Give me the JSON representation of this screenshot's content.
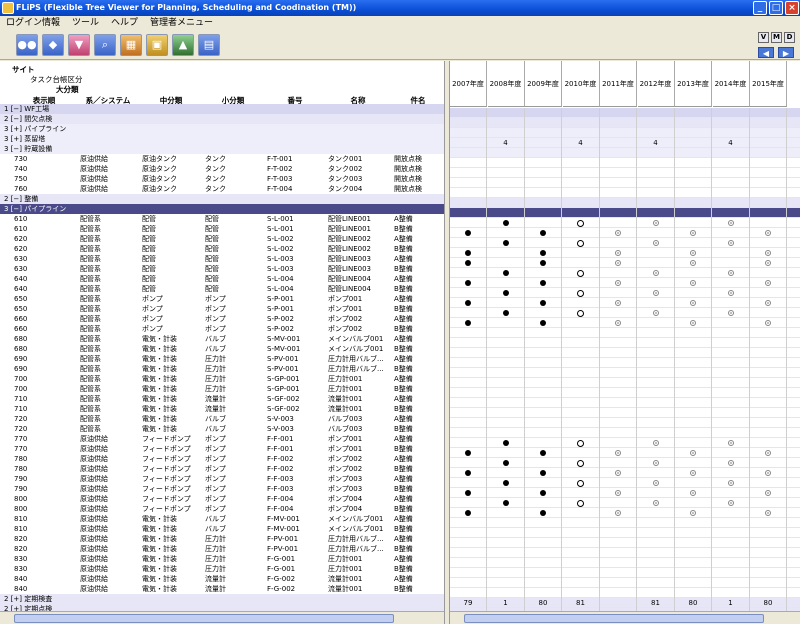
{
  "window": {
    "title": "FLiPS (Flexible Tree Viewer for Planning, Scheduling and Coodination (TM))"
  },
  "menu": [
    "ログイン情報",
    "ツール",
    "ヘルプ",
    "管理者メニュー"
  ],
  "toolbar": {
    "buttons": [
      "people-icon",
      "group-icon",
      "filter-icon",
      "search-icon",
      "grid-icon",
      "tree-icon",
      "chart-icon",
      "export-icon"
    ],
    "small": [
      "V",
      "M",
      "D"
    ]
  },
  "header": {
    "site": "サイト",
    "task": "タスク台帳区分",
    "major": "大分類",
    "cols": [
      "表示順",
      "系／システム",
      "中分類",
      "小分類",
      "番号",
      "名称",
      "件名"
    ]
  },
  "years": [
    "2007年度",
    "2008年度",
    "2009年度",
    "2010年度",
    "2011年度",
    "2012年度",
    "2013年度",
    "2014年度",
    "2015年度"
  ],
  "rows": [
    {
      "k": "g1",
      "label": "1 [−]  WF工場",
      "cells": []
    },
    {
      "k": "g2",
      "label": "2    [−]  間欠点検",
      "cells": []
    },
    {
      "k": "g3",
      "label": "3         [+]  パイプライン",
      "cells": []
    },
    {
      "k": "g3",
      "label": "3         [+]  蒸留塔",
      "cells": [
        "",
        "4",
        "",
        "4",
        "",
        "4",
        "",
        "4",
        ""
      ]
    },
    {
      "k": "g3",
      "label": "3         [−]  貯蔵設備",
      "cells": []
    },
    {
      "k": "d",
      "v": [
        "730",
        "原油供給",
        "原油タンク",
        "タンク",
        "F-T-001",
        "タンク001",
        "開放点検"
      ],
      "cells": []
    },
    {
      "k": "d",
      "v": [
        "740",
        "原油供給",
        "原油タンク",
        "タンク",
        "F-T-002",
        "タンク002",
        "開放点検"
      ],
      "cells": []
    },
    {
      "k": "d",
      "v": [
        "750",
        "原油供給",
        "原油タンク",
        "タンク",
        "F-T-003",
        "タンク003",
        "開放点検"
      ],
      "cells": []
    },
    {
      "k": "d",
      "v": [
        "760",
        "原油供給",
        "原油タンク",
        "タンク",
        "F-T-004",
        "タンク004",
        "開放点検"
      ],
      "cells": []
    },
    {
      "k": "g2",
      "label": "2    [−]  整備",
      "cells": []
    },
    {
      "k": "sel",
      "label": "3         [−]  パイプライン",
      "cells": []
    },
    {
      "k": "d",
      "v": [
        "610",
        "配管系",
        "配管",
        "配管",
        "S-L-001",
        "配管LINE001",
        "A整備"
      ],
      "cells": [
        "",
        "b",
        "",
        "o",
        "",
        "d",
        "",
        "d",
        ""
      ]
    },
    {
      "k": "d",
      "v": [
        "610",
        "配管系",
        "配管",
        "配管",
        "S-L-001",
        "配管LINE001",
        "B整備"
      ],
      "cells": [
        "b",
        "",
        "b",
        "",
        "d",
        "",
        "d",
        "",
        "d"
      ]
    },
    {
      "k": "d",
      "v": [
        "620",
        "配管系",
        "配管",
        "配管",
        "S-L-002",
        "配管LINE002",
        "A整備"
      ],
      "cells": [
        "",
        "b",
        "",
        "o",
        "",
        "d",
        "",
        "d",
        ""
      ]
    },
    {
      "k": "d",
      "v": [
        "620",
        "配管系",
        "配管",
        "配管",
        "S-L-002",
        "配管LINE002",
        "B整備"
      ],
      "cells": [
        "b",
        "",
        "b",
        "",
        "d",
        "",
        "d",
        "",
        "d"
      ]
    },
    {
      "k": "d",
      "v": [
        "630",
        "配管系",
        "配管",
        "配管",
        "S-L-003",
        "配管LINE003",
        "A整備"
      ],
      "cells": [
        "b",
        "",
        "b",
        "",
        "d",
        "",
        "d",
        "",
        "d"
      ]
    },
    {
      "k": "d",
      "v": [
        "630",
        "配管系",
        "配管",
        "配管",
        "S-L-003",
        "配管LINE003",
        "B整備"
      ],
      "cells": [
        "",
        "b",
        "",
        "o",
        "",
        "d",
        "",
        "d",
        ""
      ]
    },
    {
      "k": "d",
      "v": [
        "640",
        "配管系",
        "配管",
        "配管",
        "S-L-004",
        "配管LINE004",
        "A整備"
      ],
      "cells": [
        "b",
        "",
        "b",
        "",
        "d",
        "",
        "d",
        "",
        "d"
      ]
    },
    {
      "k": "d",
      "v": [
        "640",
        "配管系",
        "配管",
        "配管",
        "S-L-004",
        "配管LINE004",
        "B整備"
      ],
      "cells": [
        "",
        "b",
        "",
        "o",
        "",
        "d",
        "",
        "d",
        ""
      ]
    },
    {
      "k": "d",
      "v": [
        "650",
        "配管系",
        "ポンプ",
        "ポンプ",
        "S-P-001",
        "ポンプ001",
        "A整備"
      ],
      "cells": [
        "b",
        "",
        "b",
        "",
        "d",
        "",
        "d",
        "",
        "d"
      ]
    },
    {
      "k": "d",
      "v": [
        "650",
        "配管系",
        "ポンプ",
        "ポンプ",
        "S-P-001",
        "ポンプ001",
        "B整備"
      ],
      "cells": [
        "",
        "b",
        "",
        "o",
        "",
        "d",
        "",
        "d",
        ""
      ]
    },
    {
      "k": "d",
      "v": [
        "660",
        "配管系",
        "ポンプ",
        "ポンプ",
        "S-P-002",
        "ポンプ002",
        "A整備"
      ],
      "cells": [
        "b",
        "",
        "b",
        "",
        "d",
        "",
        "d",
        "",
        "d"
      ]
    },
    {
      "k": "d",
      "v": [
        "660",
        "配管系",
        "ポンプ",
        "ポンプ",
        "S-P-002",
        "ポンプ002",
        "B整備"
      ],
      "cells": []
    },
    {
      "k": "d",
      "v": [
        "680",
        "配管系",
        "電気・計装",
        "バルブ",
        "S-MV-001",
        "メインバルブ001",
        "A整備"
      ],
      "cells": []
    },
    {
      "k": "d",
      "v": [
        "680",
        "配管系",
        "電気・計装",
        "バルブ",
        "S-MV-001",
        "メインバルブ001",
        "B整備"
      ],
      "cells": []
    },
    {
      "k": "d",
      "v": [
        "690",
        "配管系",
        "電気・計装",
        "圧力計",
        "S-PV-001",
        "圧力計用バルブ...",
        "A整備"
      ],
      "cells": []
    },
    {
      "k": "d",
      "v": [
        "690",
        "配管系",
        "電気・計装",
        "圧力計",
        "S-PV-001",
        "圧力計用バルブ...",
        "B整備"
      ],
      "cells": []
    },
    {
      "k": "d",
      "v": [
        "700",
        "配管系",
        "電気・計装",
        "圧力計",
        "S-GP-001",
        "圧力計001",
        "A整備"
      ],
      "cells": []
    },
    {
      "k": "d",
      "v": [
        "700",
        "配管系",
        "電気・計装",
        "圧力計",
        "S-GP-001",
        "圧力計001",
        "B整備"
      ],
      "cells": []
    },
    {
      "k": "d",
      "v": [
        "710",
        "配管系",
        "電気・計装",
        "流量計",
        "S-GF-002",
        "流量計001",
        "A整備"
      ],
      "cells": []
    },
    {
      "k": "d",
      "v": [
        "710",
        "配管系",
        "電気・計装",
        "流量計",
        "S-GF-002",
        "流量計001",
        "B整備"
      ],
      "cells": []
    },
    {
      "k": "d",
      "v": [
        "720",
        "配管系",
        "電気・計装",
        "バルブ",
        "S-V-003",
        "バルブ003",
        "A整備"
      ],
      "cells": []
    },
    {
      "k": "d",
      "v": [
        "720",
        "配管系",
        "電気・計装",
        "バルブ",
        "S-V-003",
        "バルブ003",
        "B整備"
      ],
      "cells": []
    },
    {
      "k": "d",
      "v": [
        "770",
        "原油供給",
        "フィードポンプ",
        "ポンプ",
        "F-F-001",
        "ポンプ001",
        "A整備"
      ],
      "cells": [
        "",
        "b",
        "",
        "o",
        "",
        "d",
        "",
        "d",
        ""
      ]
    },
    {
      "k": "d",
      "v": [
        "770",
        "原油供給",
        "フィードポンプ",
        "ポンプ",
        "F-F-001",
        "ポンプ001",
        "B整備"
      ],
      "cells": [
        "b",
        "",
        "b",
        "",
        "d",
        "",
        "d",
        "",
        "d"
      ]
    },
    {
      "k": "d",
      "v": [
        "780",
        "原油供給",
        "フィードポンプ",
        "ポンプ",
        "F-F-002",
        "ポンプ002",
        "A整備"
      ],
      "cells": [
        "",
        "b",
        "",
        "o",
        "",
        "d",
        "",
        "d",
        ""
      ]
    },
    {
      "k": "d",
      "v": [
        "780",
        "原油供給",
        "フィードポンプ",
        "ポンプ",
        "F-F-002",
        "ポンプ002",
        "B整備"
      ],
      "cells": [
        "b",
        "",
        "b",
        "",
        "d",
        "",
        "d",
        "",
        "d"
      ]
    },
    {
      "k": "d",
      "v": [
        "790",
        "原油供給",
        "フィードポンプ",
        "ポンプ",
        "F-F-003",
        "ポンプ003",
        "A整備"
      ],
      "cells": [
        "",
        "b",
        "",
        "o",
        "",
        "d",
        "",
        "d",
        ""
      ]
    },
    {
      "k": "d",
      "v": [
        "790",
        "原油供給",
        "フィードポンプ",
        "ポンプ",
        "F-F-003",
        "ポンプ003",
        "B整備"
      ],
      "cells": [
        "b",
        "",
        "b",
        "",
        "d",
        "",
        "d",
        "",
        "d"
      ]
    },
    {
      "k": "d",
      "v": [
        "800",
        "原油供給",
        "フィードポンプ",
        "ポンプ",
        "F-F-004",
        "ポンプ004",
        "A整備"
      ],
      "cells": [
        "",
        "b",
        "",
        "o",
        "",
        "d",
        "",
        "d",
        ""
      ]
    },
    {
      "k": "d",
      "v": [
        "800",
        "原油供給",
        "フィードポンプ",
        "ポンプ",
        "F-F-004",
        "ポンプ004",
        "B整備"
      ],
      "cells": [
        "b",
        "",
        "b",
        "",
        "d",
        "",
        "d",
        "",
        "d"
      ]
    },
    {
      "k": "d",
      "v": [
        "810",
        "原油供給",
        "電気・計装",
        "バルブ",
        "F-MV-001",
        "メインバルブ001",
        "A整備"
      ],
      "cells": []
    },
    {
      "k": "d",
      "v": [
        "810",
        "原油供給",
        "電気・計装",
        "バルブ",
        "F-MV-001",
        "メインバルブ001",
        "B整備"
      ],
      "cells": []
    },
    {
      "k": "d",
      "v": [
        "820",
        "原油供給",
        "電気・計装",
        "圧力計",
        "F-PV-001",
        "圧力計用バルブ...",
        "A整備"
      ],
      "cells": []
    },
    {
      "k": "d",
      "v": [
        "820",
        "原油供給",
        "電気・計装",
        "圧力計",
        "F-PV-001",
        "圧力計用バルブ...",
        "B整備"
      ],
      "cells": []
    },
    {
      "k": "d",
      "v": [
        "830",
        "原油供給",
        "電気・計装",
        "圧力計",
        "F-G-001",
        "圧力計001",
        "A整備"
      ],
      "cells": []
    },
    {
      "k": "d",
      "v": [
        "830",
        "原油供給",
        "電気・計装",
        "圧力計",
        "F-G-001",
        "圧力計001",
        "B整備"
      ],
      "cells": []
    },
    {
      "k": "d",
      "v": [
        "840",
        "原油供給",
        "電気・計装",
        "流量計",
        "F-G-002",
        "流量計001",
        "A整備"
      ],
      "cells": []
    },
    {
      "k": "d",
      "v": [
        "840",
        "原油供給",
        "電気・計装",
        "流量計",
        "F-G-002",
        "流量計001",
        "B整備"
      ],
      "cells": []
    },
    {
      "k": "g2",
      "label": "2    [+]  定期検査",
      "cells": [
        "79",
        "1",
        "80",
        "81",
        "",
        "81",
        "80",
        "1",
        "80"
      ]
    },
    {
      "k": "g2",
      "label": "2    [+]  定期点検",
      "cells": []
    }
  ]
}
